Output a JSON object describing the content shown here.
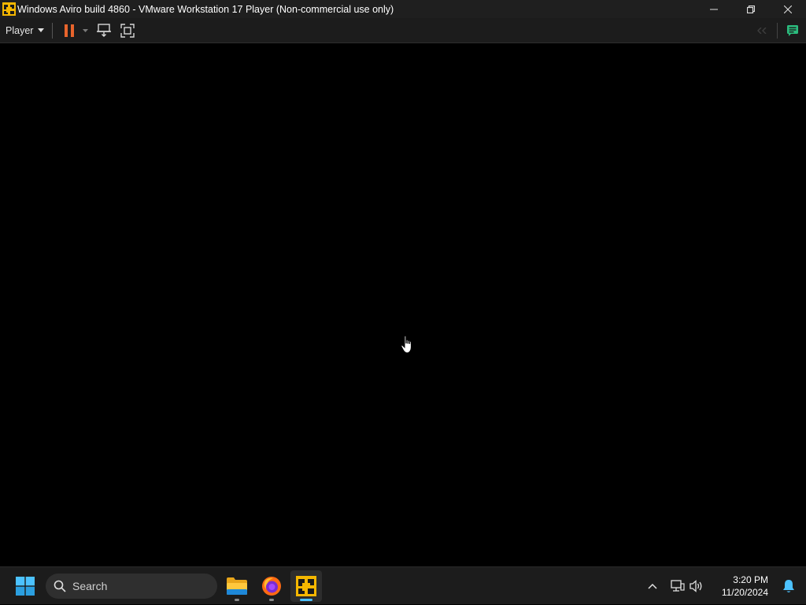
{
  "window": {
    "title": "Windows Aviro build 4860 - VMware Workstation 17 Player (Non-commercial use only)"
  },
  "toolbar": {
    "player_label": "Player"
  },
  "taskbar": {
    "search_placeholder": "Search",
    "apps": [
      "file-explorer",
      "firefox",
      "vmware-player"
    ],
    "active_app": "vmware-player"
  },
  "tray": {
    "time": "3:20 PM",
    "date": "11/20/2024"
  },
  "colors": {
    "pause_orange": "#e8642c",
    "accent_blue": "#4cc2ff",
    "vmware_yellow": "#f5b700"
  }
}
